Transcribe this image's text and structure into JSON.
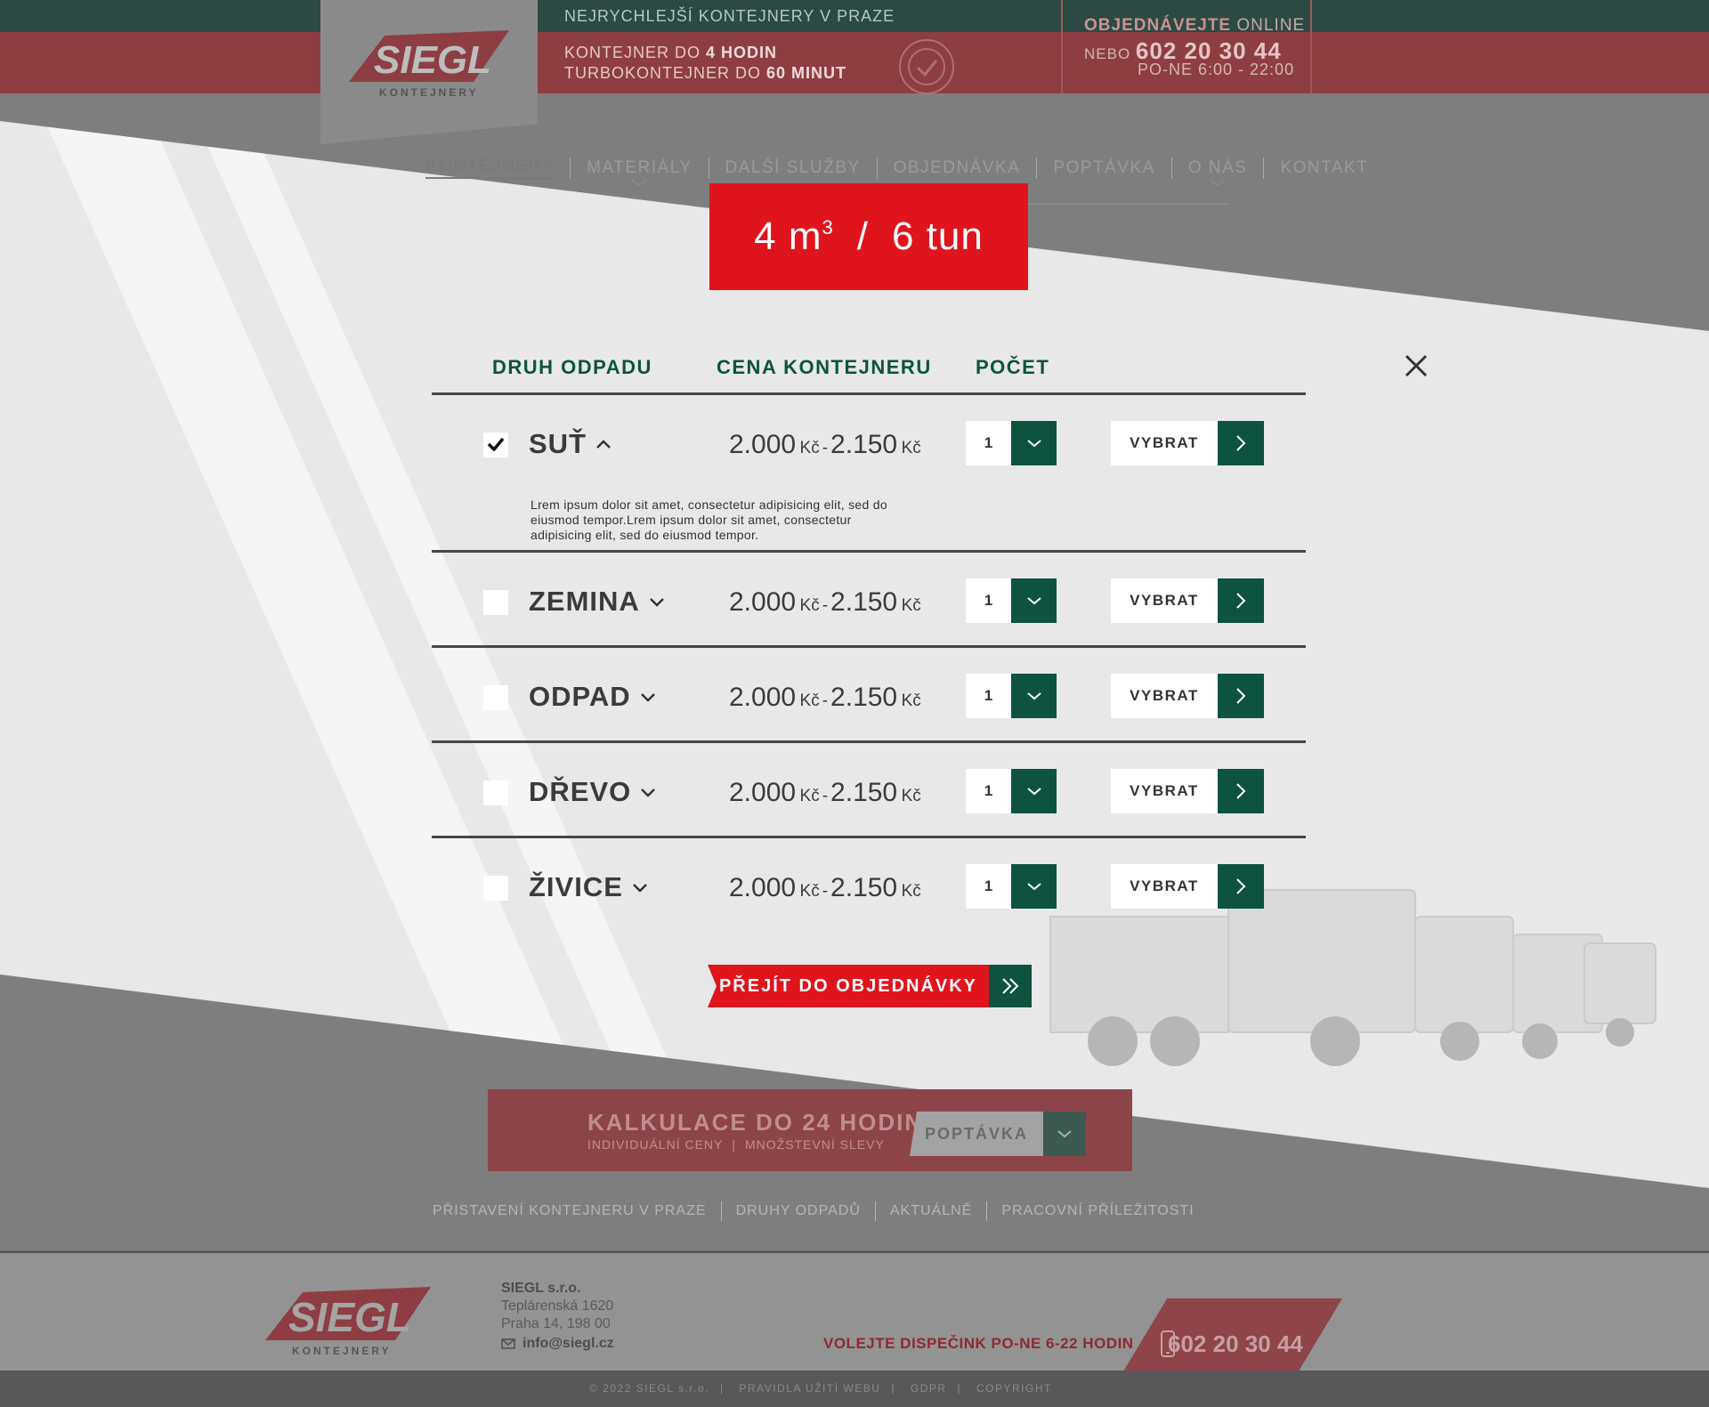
{
  "header": {
    "logo_text": "SIEGL",
    "logo_sub": "KONTEJNERY",
    "tagline": "NEJRYCHLEJŠÍ KONTEJNERY V PRAZE",
    "line1_prefix": "KONTEJNER DO ",
    "line1_bold": "4 HODIN",
    "line2_prefix": "TURBOKONTEJNER DO ",
    "line2_bold": "60 MINUT",
    "contact_order_bold": "OBJEDNÁVEJTE",
    "contact_order_rest": " ONLINE",
    "contact_or": "NEBO ",
    "contact_phone": "602 20 30 44",
    "contact_hours": "PO-NE 6:00 - 22:00"
  },
  "nav": {
    "items": [
      {
        "label": "KONTEJNERY",
        "active": true,
        "has_dropdown": false
      },
      {
        "label": "MATERIÁLY",
        "active": false,
        "has_dropdown": true
      },
      {
        "label": "DALŠÍ SLUŽBY",
        "active": false,
        "has_dropdown": false
      },
      {
        "label": "OBJEDNÁVKA",
        "active": false,
        "has_dropdown": false
      },
      {
        "label": "POPTÁVKA",
        "active": false,
        "has_dropdown": false
      },
      {
        "label": "O NÁS",
        "active": false,
        "has_dropdown": true
      },
      {
        "label": "KONTAKT",
        "active": false,
        "has_dropdown": false
      }
    ]
  },
  "modal": {
    "size_volume": "4 m",
    "size_exp": "3",
    "size_sep": "/",
    "size_weight": "6 tun",
    "columns": [
      "DRUH ODPADU",
      "CENA KONTEJNERU",
      "POČET"
    ],
    "rows": [
      {
        "name": "SUŤ",
        "checked": true,
        "expanded": true,
        "price_from": "2.000",
        "price_to": "2.150",
        "currency": "Kč",
        "qty": "1",
        "button": "VYBRAT",
        "description": "Lrem ipsum dolor sit amet, consectetur adipisicing elit, sed do eiusmod tempor.Lrem ipsum dolor sit amet, consectetur adipisicing elit, sed do eiusmod tempor."
      },
      {
        "name": "ZEMINA",
        "checked": false,
        "expanded": false,
        "price_from": "2.000",
        "price_to": "2.150",
        "currency": "Kč",
        "qty": "1",
        "button": "VYBRAT"
      },
      {
        "name": "ODPAD",
        "checked": false,
        "expanded": false,
        "price_from": "2.000",
        "price_to": "2.150",
        "currency": "Kč",
        "qty": "1",
        "button": "VYBRAT"
      },
      {
        "name": "DŘEVO",
        "checked": false,
        "expanded": false,
        "price_from": "2.000",
        "price_to": "2.150",
        "currency": "Kč",
        "qty": "1",
        "button": "VYBRAT"
      },
      {
        "name": "ŽIVICE",
        "checked": false,
        "expanded": false,
        "price_from": "2.000",
        "price_to": "2.150",
        "currency": "Kč",
        "qty": "1",
        "button": "VYBRAT"
      }
    ],
    "order_button": "PŘEJÍT DO OBJEDNÁVKY"
  },
  "calc": {
    "title": "KALKULACE DO 24 HODIN",
    "sub1": "INDIVIDUÁLNÍ CENY",
    "sub2": "MNOŽSTEVNÍ SLEVY",
    "button": "POPTÁVKA"
  },
  "footer_links": [
    "PŘISTAVENÍ KONTEJNERU V PRAZE",
    "DRUHY ODPADŮ",
    "AKTUÁLNĚ",
    "PRACOVNÍ PŘÍLEŽITOSTI"
  ],
  "footer": {
    "company_name": "SIEGL s.r.o.",
    "street": "Teplárenská 1620",
    "city": "Praha 14, 198 00",
    "email": "info@siegl.cz",
    "dispatch_text": "VOLEJTE DISPEČINK PO-NE 6-22 HODIN",
    "phone": "602 20 30 44"
  },
  "copyright": [
    "© 2022 SIEGL s.r.o.",
    "PRAVIDLA UŽITÍ WEBU",
    "GDPR",
    "COPYRIGHT"
  ],
  "colors": {
    "brand_red": "#e0141d",
    "brand_green": "#0d5340",
    "text_dark": "#3b3b3b"
  }
}
